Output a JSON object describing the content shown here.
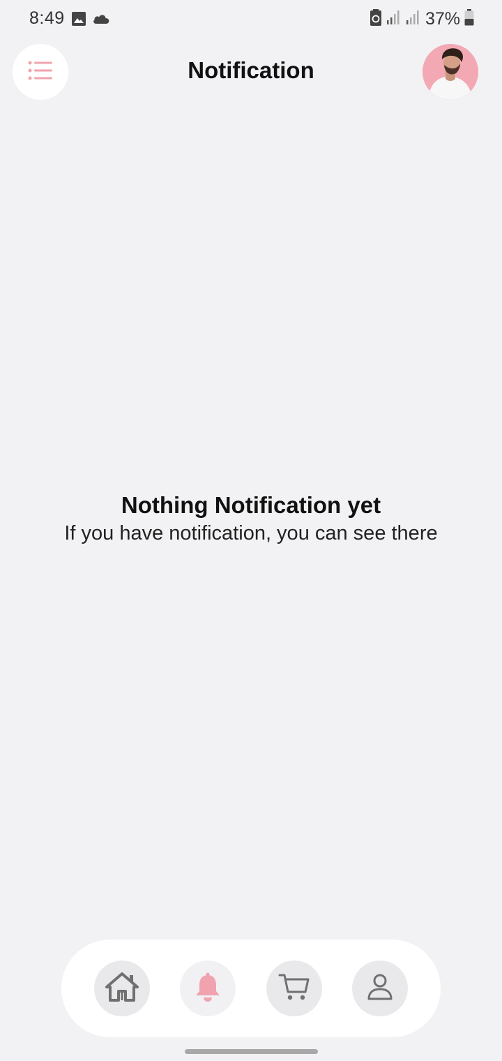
{
  "status_bar": {
    "time": "8:49",
    "battery_percent": "37%",
    "icons": [
      "image-icon",
      "cloud-icon",
      "battery-saver-icon",
      "signal-icon",
      "signal-icon",
      "battery-icon"
    ]
  },
  "header": {
    "title": "Notification",
    "menu_icon": "list-icon",
    "avatar": "user-avatar"
  },
  "empty_state": {
    "title": "Nothing Notification yet",
    "subtitle": "If you have notification, you can see there"
  },
  "bottom_nav": {
    "items": [
      {
        "icon": "home-icon",
        "active": false
      },
      {
        "icon": "bell-icon",
        "active": true
      },
      {
        "icon": "cart-icon",
        "active": false
      },
      {
        "icon": "user-icon",
        "active": false
      }
    ]
  },
  "colors": {
    "background": "#f2f2f4",
    "accent": "#f0a3ae",
    "icon_gray": "#707070",
    "surface": "#ffffff"
  }
}
